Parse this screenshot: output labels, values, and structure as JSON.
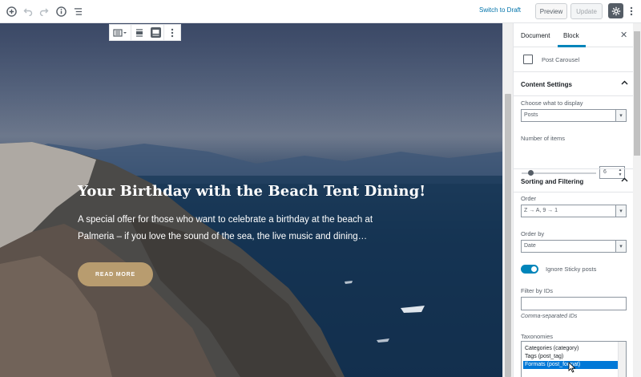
{
  "topbar": {
    "add_icon": "plus-circle-icon",
    "undo_icon": "undo-icon",
    "redo_icon": "redo-icon",
    "info_icon": "info-icon",
    "outline_icon": "list-icon",
    "switch_to_draft": "Switch to Draft",
    "preview": "Preview",
    "update": "Update",
    "settings_icon": "gear-icon",
    "more_icon": "more-vertical-icon"
  },
  "block_toolbar": {
    "type_icon": "post-carousel-icon",
    "align_icon": "align-wide-icon",
    "fullwidth_icon": "align-full-icon",
    "more_icon": "more-vertical-icon"
  },
  "hero": {
    "title": "Your Birthday with the Beach Tent Dining!",
    "text": "A special offer for those who want to celebrate a birthday at the beach at Palmeria – if you love the sound of the sea, the live music and dining…",
    "button": "READ MORE"
  },
  "sidebar": {
    "tabs": [
      "Document",
      "Block"
    ],
    "active_tab": "Block",
    "close_icon": "close-icon",
    "block_name": "Post Carousel",
    "content_settings": {
      "title": "Content Settings",
      "display_label": "Choose what to display",
      "display_value": "Posts",
      "items_label": "Number of items",
      "items_value": "6",
      "items_fraction": 0.08
    },
    "sorting": {
      "title": "Sorting and Filtering",
      "order_label": "Order",
      "order_value": "Z → A, 9 → 1",
      "orderby_label": "Order by",
      "orderby_value": "Date",
      "sticky_label": "Ignore Sticky posts",
      "sticky_on": true,
      "filter_label": "Filter by IDs",
      "filter_value": "",
      "filter_help": "Comma-separated IDs",
      "taxonomies_label": "Taxonomies",
      "taxonomies": [
        "Categories (category)",
        "Tags (post_tag)",
        "Formats (post_format)"
      ],
      "taxonomies_selected": "Formats (post_format)"
    }
  },
  "colors": {
    "accent": "#0085ba",
    "button_gold": "#b89c6f",
    "link": "#0073aa"
  }
}
